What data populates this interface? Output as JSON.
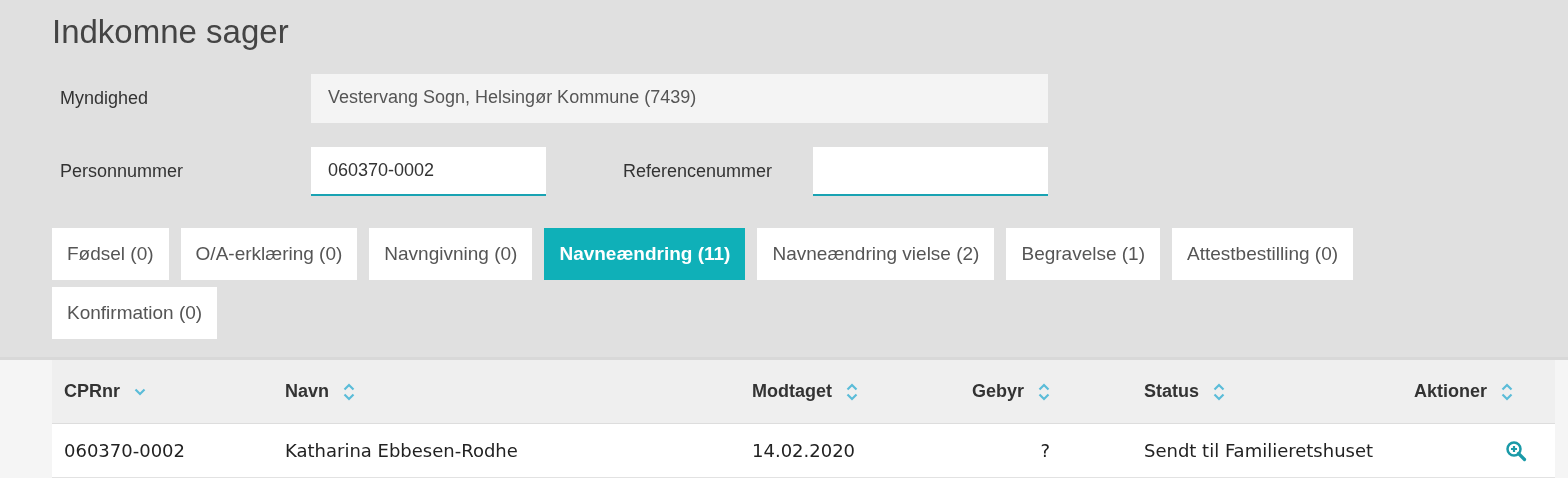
{
  "title": "Indkomne sager",
  "fields": [
    {
      "label": "Myndighed",
      "value": "Vestervang Sogn, Helsingør Kommune (7439)",
      "disabled": true
    },
    {
      "label": "Personnummer",
      "value": "060370-0002",
      "disabled": false
    },
    {
      "label": "Referencenummer",
      "disabled": false
    }
  ],
  "tabs": [
    {
      "label": "Fødsel (0)",
      "selected": false
    },
    {
      "label": "O/A-erklæring (0)",
      "selected": false
    },
    {
      "label": "Navngivning (0)",
      "selected": false
    },
    {
      "label": "Navneændring (11)",
      "selected": true
    },
    {
      "label": "Navneændring vielse (2)",
      "selected": false
    },
    {
      "label": "Begravelse (1)",
      "selected": false
    },
    {
      "label": "Attestbestilling (0)",
      "selected": false
    },
    {
      "label": "Konfirmation (0)",
      "selected": false
    }
  ],
  "table": {
    "columns": [
      {
        "label": "CPRnr",
        "sorted": true
      },
      {
        "label": "Navn",
        "sorted": false
      },
      {
        "label": "Modtaget",
        "sorted": false
      },
      {
        "label": "Gebyr",
        "sorted": false
      },
      {
        "label": "Status",
        "sorted": false
      },
      {
        "label": "Aktioner",
        "sorted": false
      }
    ],
    "rows": [
      {
        "cprnr": "060370-0002",
        "navn": "Katharina Ebbesen-Rodhe",
        "modtaget": "14.02.2020",
        "gebyr": "?",
        "status": "Sendt til Familieretshuset"
      }
    ]
  }
}
